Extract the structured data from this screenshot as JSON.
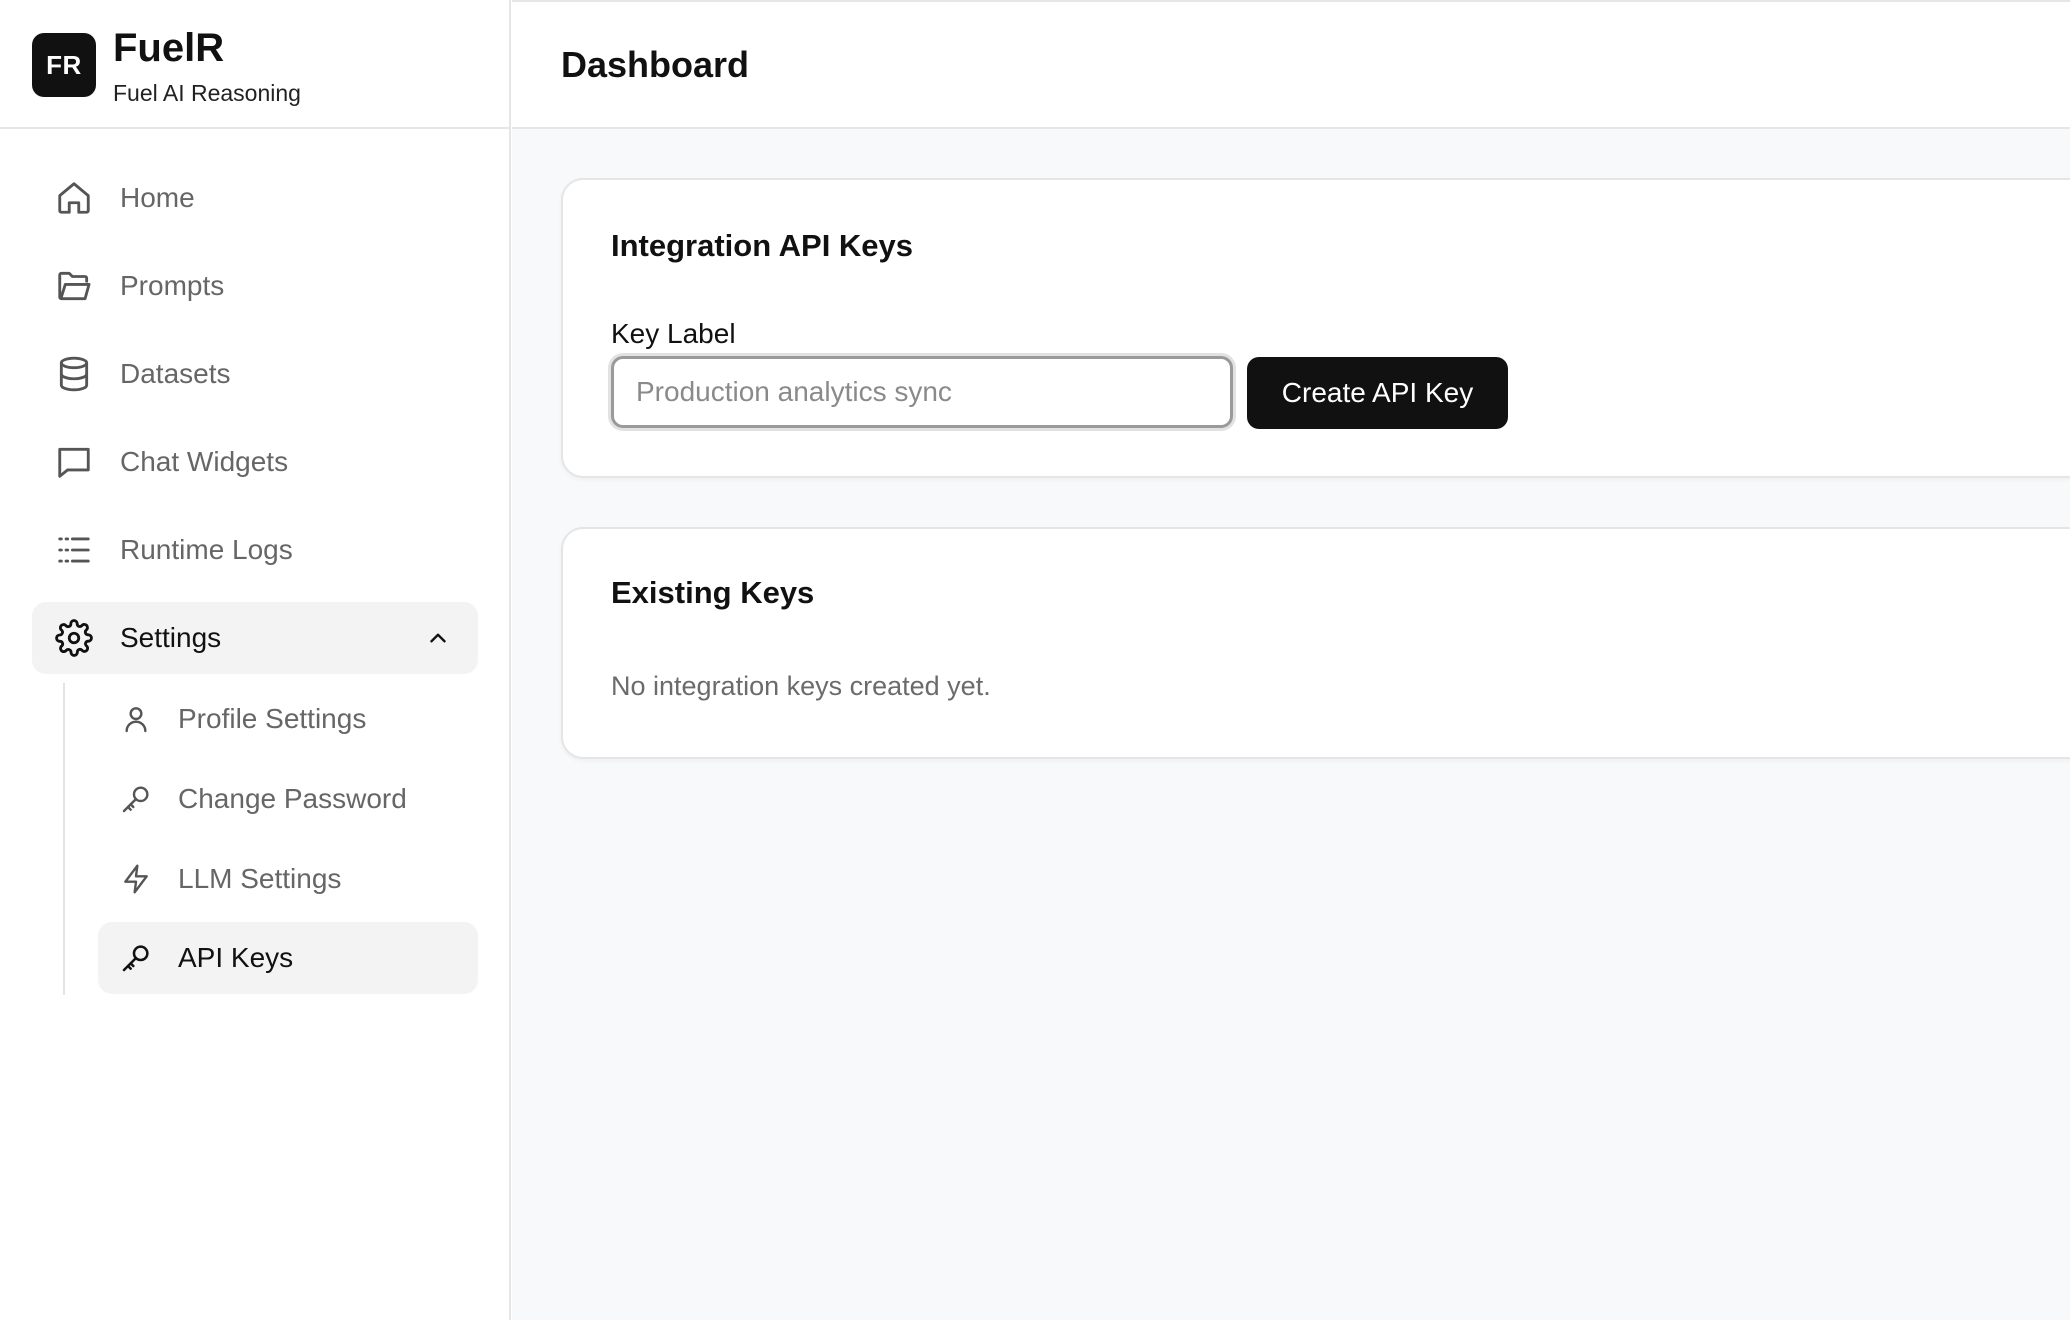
{
  "brand": {
    "logo_initials": "FR",
    "name": "FuelR",
    "tagline": "Fuel AI Reasoning"
  },
  "sidebar": {
    "items": [
      {
        "label": "Home",
        "icon": "home-icon"
      },
      {
        "label": "Prompts",
        "icon": "folder-open-icon"
      },
      {
        "label": "Datasets",
        "icon": "database-icon"
      },
      {
        "label": "Chat Widgets",
        "icon": "message-square-icon"
      },
      {
        "label": "Runtime Logs",
        "icon": "list-icon"
      },
      {
        "label": "Settings",
        "icon": "gear-icon",
        "expanded": true
      }
    ],
    "settings_sub": [
      {
        "label": "Profile Settings",
        "icon": "user-icon"
      },
      {
        "label": "Change Password",
        "icon": "key-icon"
      },
      {
        "label": "LLM Settings",
        "icon": "zap-icon"
      },
      {
        "label": "API Keys",
        "icon": "key-icon",
        "active": true
      }
    ]
  },
  "header": {
    "title": "Dashboard"
  },
  "integration_card": {
    "title": "Integration API Keys",
    "field_label": "Key Label",
    "input_value": "",
    "input_placeholder": "Production analytics sync",
    "create_button_label": "Create API Key"
  },
  "existing_card": {
    "title": "Existing Keys",
    "empty_message": "No integration keys created yet."
  },
  "colors": {
    "accent": "#111111",
    "active_bg": "#f3f3f4",
    "main_bg": "#f8f9fa",
    "muted_text": "#666666"
  }
}
